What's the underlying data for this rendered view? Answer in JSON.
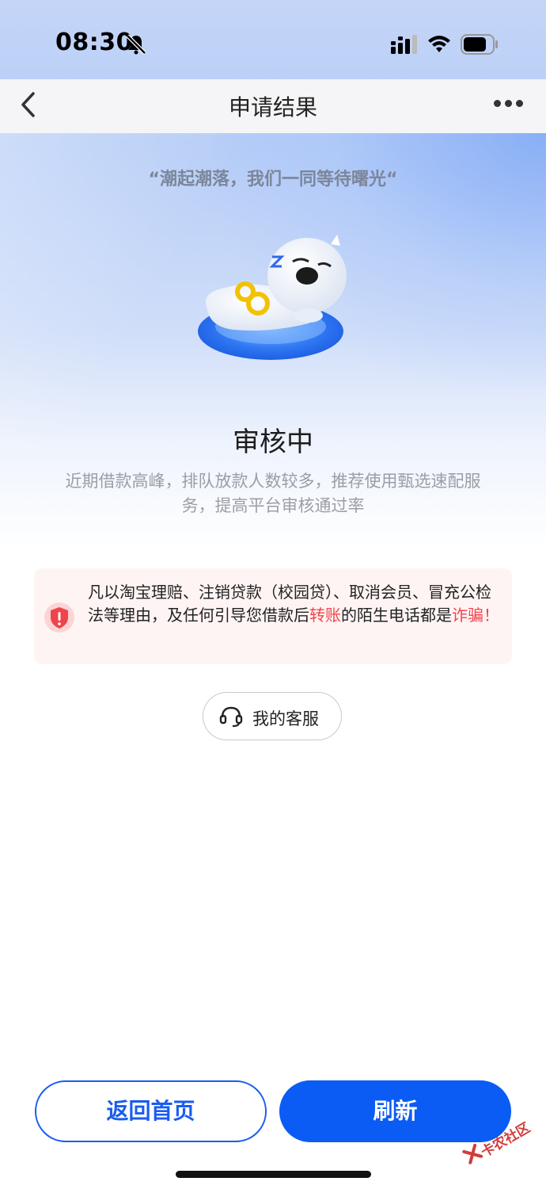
{
  "status_bar": {
    "time": "08:30"
  },
  "nav": {
    "title": "申请结果"
  },
  "hero": {
    "slogan": "“潮起潮落，我们一同等待曙光“",
    "status_title": "审核中",
    "status_desc": "近期借款高峰，排队放款人数较多，推荐使用甄选速配服务，提高平台审核通过率"
  },
  "warning": {
    "text_part1": "凡以淘宝理赔、注销贷款（校园贷）、取消会员、冒充公检法等理由，及任何引导您借款后",
    "text_highlight1": "转账",
    "text_part2": "的陌生电话都是",
    "text_highlight2": "诈骗",
    "text_part3": "！"
  },
  "service": {
    "label": "我的客服"
  },
  "footer": {
    "home_label": "返回首页",
    "refresh_label": "刷新"
  },
  "watermark": {
    "text": "卡农社区"
  },
  "colors": {
    "primary": "#0b5cf5",
    "warning_highlight": "#f0444b",
    "warning_bg": "#fff4f4"
  }
}
